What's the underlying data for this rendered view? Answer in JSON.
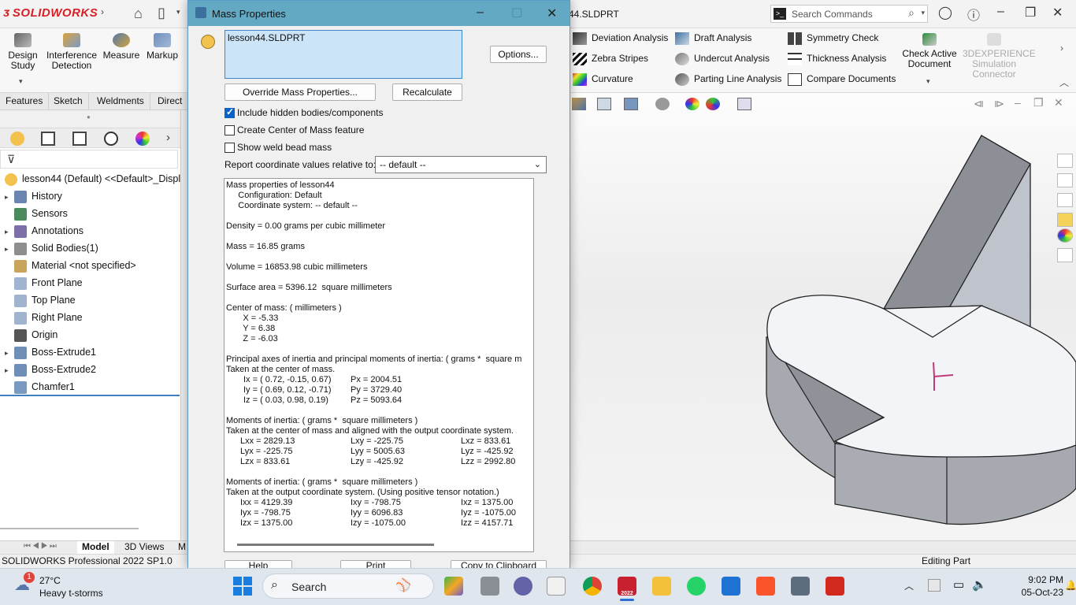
{
  "app": {
    "brand": "SOLIDWORKS",
    "file_title": "44.SLDPRT",
    "search_placeholder": "Search Commands"
  },
  "ribbon": {
    "left_tools": [
      {
        "label": "Design\nStudy"
      },
      {
        "label": "Interference\nDetection"
      },
      {
        "label": "Measure"
      },
      {
        "label": "Markup"
      }
    ],
    "col1": [
      "Deviation Analysis",
      "Zebra Stripes",
      "Curvature"
    ],
    "col2": [
      "Draft Analysis",
      "Undercut Analysis",
      "Parting Line Analysis"
    ],
    "col3": [
      "Symmetry Check",
      "Thickness Analysis",
      "Compare Documents"
    ],
    "check_active": "Check Active\nDocument",
    "experience": "3DEXPERIENCE\nSimulation\nConnector"
  },
  "cm_tabs": [
    "Features",
    "Sketch",
    "Weldments",
    "Direct E"
  ],
  "feature_tree": {
    "root": "lesson44 (Default) <<Default>_Display",
    "items": [
      {
        "label": "History",
        "expand": true
      },
      {
        "label": "Sensors",
        "expand": false
      },
      {
        "label": "Annotations",
        "expand": true
      },
      {
        "label": "Solid Bodies(1)",
        "expand": true
      },
      {
        "label": "Material <not specified>",
        "expand": false
      },
      {
        "label": "Front Plane",
        "expand": false
      },
      {
        "label": "Top Plane",
        "expand": false
      },
      {
        "label": "Right Plane",
        "expand": false
      },
      {
        "label": "Origin",
        "expand": false
      },
      {
        "label": "Boss-Extrude1",
        "expand": true
      },
      {
        "label": "Boss-Extrude2",
        "expand": true
      },
      {
        "label": "Chamfer1",
        "expand": false
      }
    ]
  },
  "model_tabs": [
    "Model",
    "3D Views",
    "M"
  ],
  "status": {
    "left": "SOLIDWORKS Professional 2022 SP1.0",
    "right": "Editing Part"
  },
  "dialog": {
    "title": "Mass Properties",
    "selection": "lesson44.SLDPRT",
    "options_label": "Options...",
    "override_label": "Override Mass Properties...",
    "recalc_label": "Recalculate",
    "chk_hidden": "Include hidden bodies/components",
    "chk_hidden_on": true,
    "chk_com": "Create Center of Mass feature",
    "chk_weld": "Show weld bead mass",
    "coord_label": "Report coordinate values relative to:",
    "coord_value": "-- default --",
    "help_label": "Help",
    "print_label": "Print",
    "copy_label": "Copy to Clipboard",
    "results": [
      "Mass properties of lesson44",
      "     Configuration: Default",
      "     Coordinate system: -- default --",
      "",
      "Density = 0.00 grams per cubic millimeter",
      "",
      "Mass = 16.85 grams",
      "",
      "Volume = 16853.98 cubic millimeters",
      "",
      "Surface area = 5396.12  square millimeters",
      "",
      "Center of mass: ( millimeters )",
      "       X = -5.33",
      "       Y = 6.38",
      "       Z = -6.03",
      "",
      "Principal axes of inertia and principal moments of inertia: ( grams *  square m",
      "Taken at the center of mass.",
      "",
      "",
      "",
      "",
      "Moments of inertia: ( grams *  square millimeters )",
      "Taken at the center of mass and aligned with the output coordinate system.",
      "",
      "",
      "",
      "",
      "Moments of inertia: ( grams *  square millimeters )",
      "Taken at the output coordinate system. (Using positive tensor notation.)"
    ],
    "principal": [
      [
        "Ix = ( 0.72, -0.15,  0.67)",
        "Px = 2004.51"
      ],
      [
        "Iy = ( 0.69,  0.12, -0.71)",
        "Py = 3729.40"
      ],
      [
        "Iz = ( 0.03,  0.98,  0.19)",
        "Pz = 5093.64"
      ]
    ],
    "moments_com": [
      [
        "Lxx = 2829.13",
        "Lxy = -225.75",
        "Lxz = 833.61"
      ],
      [
        "Lyx = -225.75",
        "Lyy = 5005.63",
        "Lyz = -425.92"
      ],
      [
        "Lzx = 833.61",
        "Lzy = -425.92",
        "Lzz = 2992.80"
      ]
    ],
    "moments_out": [
      [
        "Ixx = 4129.39",
        "Ixy = -798.75",
        "Ixz = 1375.00"
      ],
      [
        "Iyx = -798.75",
        "Iyy = 6096.83",
        "Iyz = -1075.00"
      ],
      [
        "Izx = 1375.00",
        "Izy = -1075.00",
        "Izz = 4157.71"
      ]
    ]
  },
  "taskbar": {
    "temp": "27°C",
    "weather": "Heavy t-storms",
    "weather_badge": "1",
    "search": "Search",
    "time": "9:02 PM",
    "date": "05-Oct-23",
    "sw_badge": "2022"
  },
  "colors": {
    "accent": "#3c86c8",
    "title_bar": "#64a9c3",
    "brand_red": "#d81f26"
  }
}
